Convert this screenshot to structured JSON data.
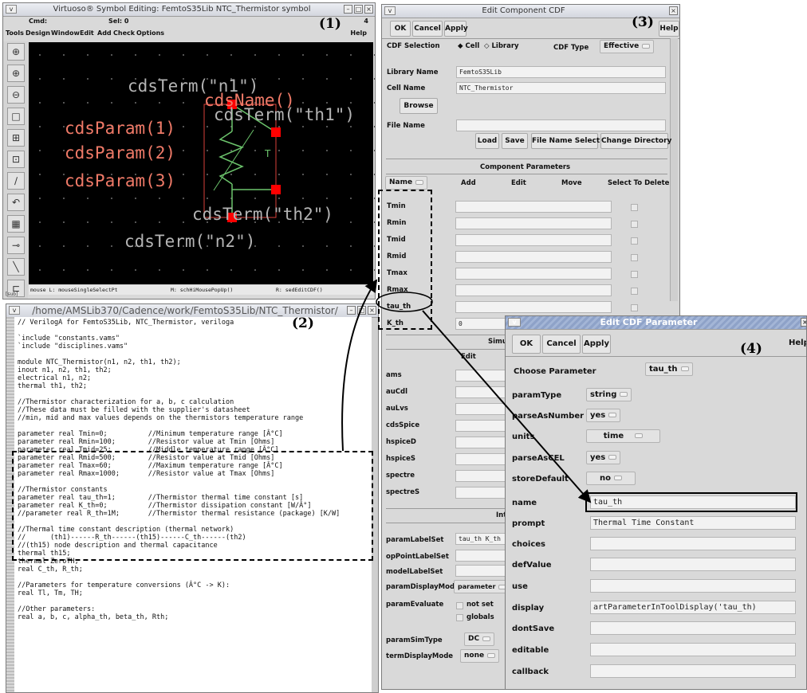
{
  "callouts": [
    "(1)",
    "(2)",
    "(3)",
    "(4)"
  ],
  "win1": {
    "title": "Virtuoso® Symbol Editing: FemtoS35Lib NTC_Thermistor symbol",
    "cmd_label": "Cmd:",
    "sel_label": "Sel: 0",
    "count": "4",
    "menus": [
      "Tools",
      "Design",
      "Window",
      "Edit",
      "Add",
      "Check",
      "Options"
    ],
    "help": "Help",
    "canvas": {
      "labels": [
        "cdsTerm(\"n1\")",
        "cdsName()",
        "cdsTerm(\"th1\")",
        "cdsParam(1)",
        "cdsParam(2)",
        "cdsParam(3)",
        "cdsTerm(\"th2\")",
        "cdsTerm(\"n2\")"
      ],
      "temp_symbol": "T",
      "colors": {
        "background": "#000000",
        "label": "#b4b4b4",
        "param": "#f07a68",
        "pin": "#ff0000",
        "body": "#6cc46c",
        "grid": "#545454"
      }
    },
    "status": [
      "mouse L: mouseSingleSelectPt",
      "M: schHiMousePopUp()",
      "R: sedEditCDF()"
    ],
    "tools": [
      "pointer-icon",
      "zoom-in-icon",
      "zoom-out-icon",
      "fit-icon",
      "window-icon",
      "select-icon",
      "pen-icon",
      "undo-icon",
      "grid-icon",
      "pin-icon",
      "line-icon",
      "rect-icon"
    ],
    "footer": "[sub]"
  },
  "win2": {
    "title": "/home/AMSLib370/Cadence/work/FemtoS35Lib/NTC_Thermistor/",
    "lines": [
      "// VerilogA for FemtoS35Lib, NTC_Thermistor, veriloga",
      "",
      "`include \"constants.vams\"",
      "`include \"disciplines.vams\"",
      "",
      "module NTC_Thermistor(n1, n2, th1, th2);",
      "inout n1, n2, th1, th2;",
      "electrical n1, n2;",
      "thermal th1, th2;",
      "",
      "//Thermistor characterization for a, b, c calculation",
      "//These data must be filled with the supplier's datasheet",
      "//min, mid and max values depends on the thermistors temperature range",
      "",
      "parameter real Tmin=0;          //Minimum temperature range [Â°C]",
      "parameter real Rmin=100;        //Resistor value at Tmin [Ohms]",
      "parameter real Tmid=25;         //Middle temperature range [Â°C]",
      "parameter real Rmid=500;        //Resistor value at Tmid [Ohms]",
      "parameter real Tmax=60;         //Maximum temperature range [Â°C]",
      "parameter real Rmax=1000;       //Resistor value at Tmax [Ohms]",
      "",
      "//Thermistor constants",
      "parameter real tau_th=1;        //Thermistor thermal time constant [s]",
      "parameter real K_th=0;          //Thermistor dissipation constant [W/Â°]",
      "//parameter real R_th=1M;       //Thermistor thermal resistance (package) [K/W]",
      "",
      "//Thermal time constant description (thermal network)",
      "//      (th1)------R_th------(th15)------C_th------(th2)",
      "//(th15) node description and thermal capacitance",
      "thermal th15;",
      "thermal ZeroTH;",
      "real C_th, R_th;",
      "",
      "//Parameters for temperature conversions (Â°C -> K):",
      "real Tl, Tm, TH;",
      "",
      "//Other parameters:",
      "real a, b, c, alpha_th, beta_th, Rth;"
    ]
  },
  "win3": {
    "title": "Edit Component CDF",
    "ok": "OK",
    "cancel": "Cancel",
    "apply": "Apply",
    "help": "Help",
    "cdf_selection_label": "CDF Selection",
    "cell_option": "Cell",
    "library_option": "Library",
    "cdf_type_label": "CDF Type",
    "cdf_type_value": "Effective",
    "library_name_label": "Library Name",
    "library_name_value": "FemtoS35Lib",
    "cell_name_label": "Cell Name",
    "cell_name_value": "NTC_Thermistor",
    "browse": "Browse",
    "file_name_label": "File Name",
    "load": "Load",
    "save": "Save",
    "file_name_select": "File Name Select",
    "change_directory": "Change Directory",
    "component_parameters": "Component Parameters",
    "name_header": "Name",
    "add": "Add",
    "edit": "Edit",
    "move": "Move",
    "select_to_delete": "Select To Delete",
    "params": [
      {
        "name": "Tmin",
        "value": ""
      },
      {
        "name": "Rmin",
        "value": ""
      },
      {
        "name": "Tmid",
        "value": ""
      },
      {
        "name": "Rmid",
        "value": ""
      },
      {
        "name": "Tmax",
        "value": ""
      },
      {
        "name": "Rmax",
        "value": ""
      },
      {
        "name": "tau_th",
        "value": ""
      },
      {
        "name": "K_th",
        "value": "0"
      }
    ],
    "simulation_header": "Simulat",
    "sim_edit": "Edit",
    "simulators": [
      "ams",
      "auCdl",
      "auLvs",
      "cdsSpice",
      "hspiceD",
      "hspiceS",
      "spectre",
      "spectreS"
    ],
    "interpreted_header": "Interpre",
    "param_label_set_label": "paramLabelSet",
    "param_label_set_value": "tau_th K_th",
    "op_point_label_set": "opPointLabelSet",
    "model_label_set": "modelLabelSet",
    "param_display_mode_label": "paramDisplayMode",
    "param_display_mode_value": "parameter",
    "param_evaluate_label": "paramEvaluate",
    "not_set": "not set",
    "globals": "globals",
    "param_sim_type_label": "paramSimType",
    "param_sim_type_value": "DC",
    "term_display_mode_label": "termDisplayMode",
    "term_display_mode_value": "none"
  },
  "win4": {
    "title": "Edit CDF Parameter",
    "ok": "OK",
    "cancel": "Cancel",
    "apply": "Apply",
    "help": "Help",
    "choose_parameter_label": "Choose Parameter",
    "choose_parameter_value": "tau_th",
    "param_type_label": "paramType",
    "param_type_value": "string",
    "parse_as_number_label": "parseAsNumber",
    "parse_as_number_value": "yes",
    "units_label": "units",
    "units_value": "time",
    "parse_as_cel_label": "parseAsCEL",
    "parse_as_cel_value": "yes",
    "store_default_label": "storeDefault",
    "store_default_value": "no",
    "name_label": "name",
    "name_value": "tau_th",
    "prompt_label": "prompt",
    "prompt_value": "Thermal Time Constant",
    "choices_label": "choices",
    "def_value_label": "defValue",
    "use_label": "use",
    "display_label": "display",
    "display_value": "artParameterInToolDisplay('tau_th)",
    "dont_save_label": "dontSave",
    "editable_label": "editable",
    "callback_label": "callback"
  }
}
